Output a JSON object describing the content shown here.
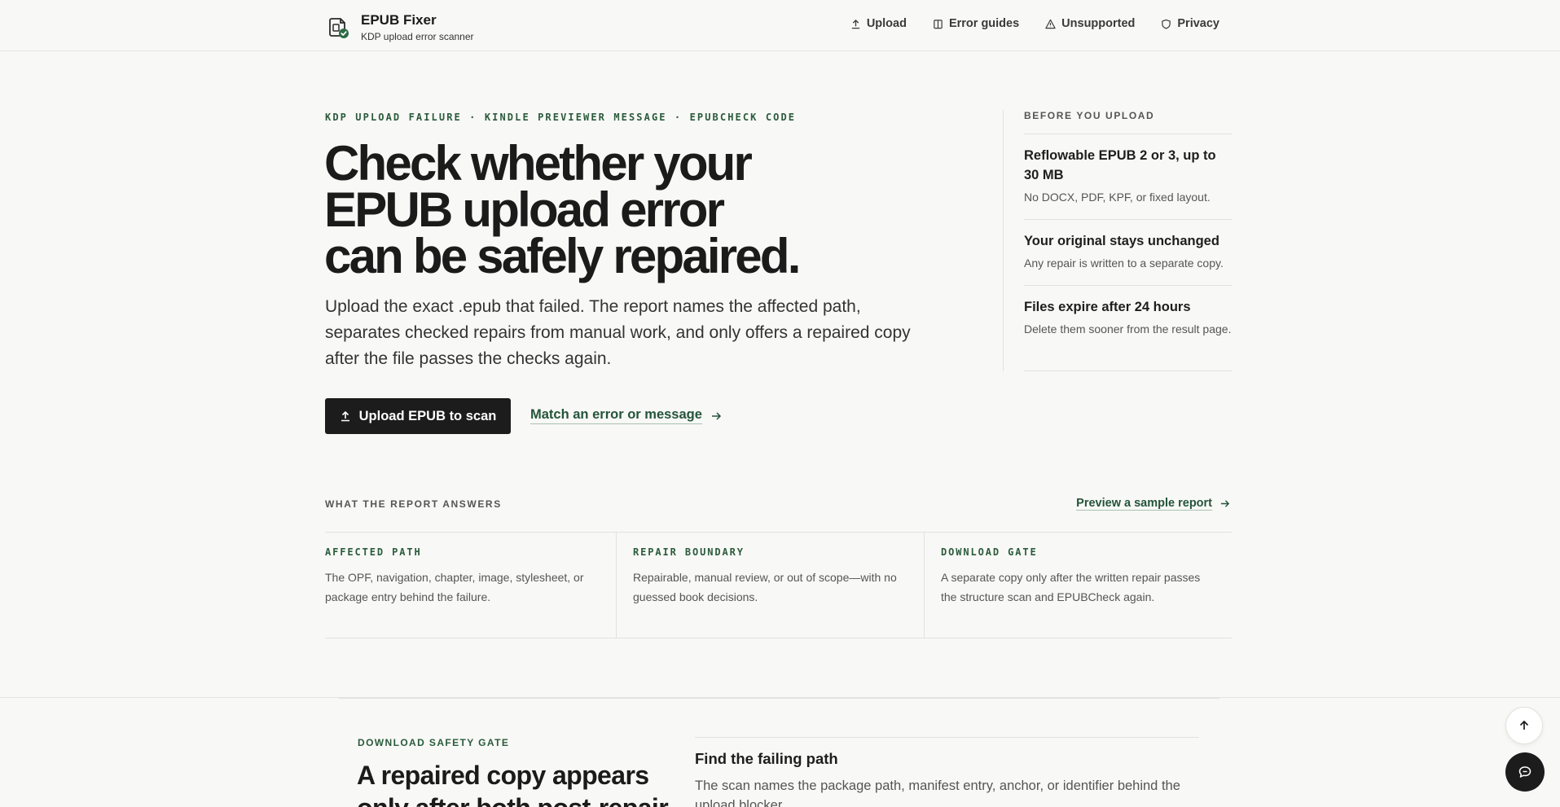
{
  "header": {
    "brand_title": "EPUB Fixer",
    "brand_subtitle": "KDP upload error scanner",
    "nav": [
      {
        "label": "Upload",
        "icon": "upload-icon"
      },
      {
        "label": "Error guides",
        "icon": "book-icon"
      },
      {
        "label": "Unsupported",
        "icon": "warning-icon"
      },
      {
        "label": "Privacy",
        "icon": "shield-icon"
      }
    ]
  },
  "hero": {
    "eyebrow": "KDP UPLOAD FAILURE · KINDLE PREVIEWER MESSAGE · EPUBCHECK CODE",
    "title_line1": "Check whether your",
    "title_line2": "EPUB upload error",
    "title_line3": "can be safely repaired.",
    "description": "Upload the exact .epub that failed. The report names the affected path, separates checked repairs from manual work, and only offers a repaired copy after the file passes the checks again.",
    "primary_button": "Upload EPUB to scan",
    "secondary_link": "Match an error or message"
  },
  "aside": {
    "label": "BEFORE YOU UPLOAD",
    "items": [
      {
        "title": "Reflowable EPUB 2 or 3, up to 30 MB",
        "text": "No DOCX, PDF, KPF, or fixed layout."
      },
      {
        "title": "Your original stays unchanged",
        "text": "Any repair is written to a separate copy."
      },
      {
        "title": "Files expire after 24 hours",
        "text": "Delete them sooner from the result page."
      }
    ]
  },
  "report": {
    "label": "WHAT THE REPORT ANSWERS",
    "preview_link": "Preview a sample report",
    "cards": [
      {
        "key": "AFFECTED PATH",
        "text": "The OPF, navigation, chapter, image, stylesheet, or package entry behind the failure."
      },
      {
        "key": "REPAIR BOUNDARY",
        "text": "Repairable, manual review, or out of scope—with no guessed book decisions."
      },
      {
        "key": "DOWNLOAD GATE",
        "text": "A separate copy only after the written repair passes the structure scan and EPUBCheck again."
      }
    ]
  },
  "lower": {
    "eyebrow": "DOWNLOAD SAFETY GATE",
    "title": "A repaired copy appears only after both post-repair",
    "step_title": "Find the failing path",
    "step_text": "The scan names the package path, manifest entry, anchor, or identifier behind the upload blocker."
  },
  "colors": {
    "accent": "#24543a",
    "primary_button": "#1c1c1c",
    "background": "#f8f8f6"
  }
}
